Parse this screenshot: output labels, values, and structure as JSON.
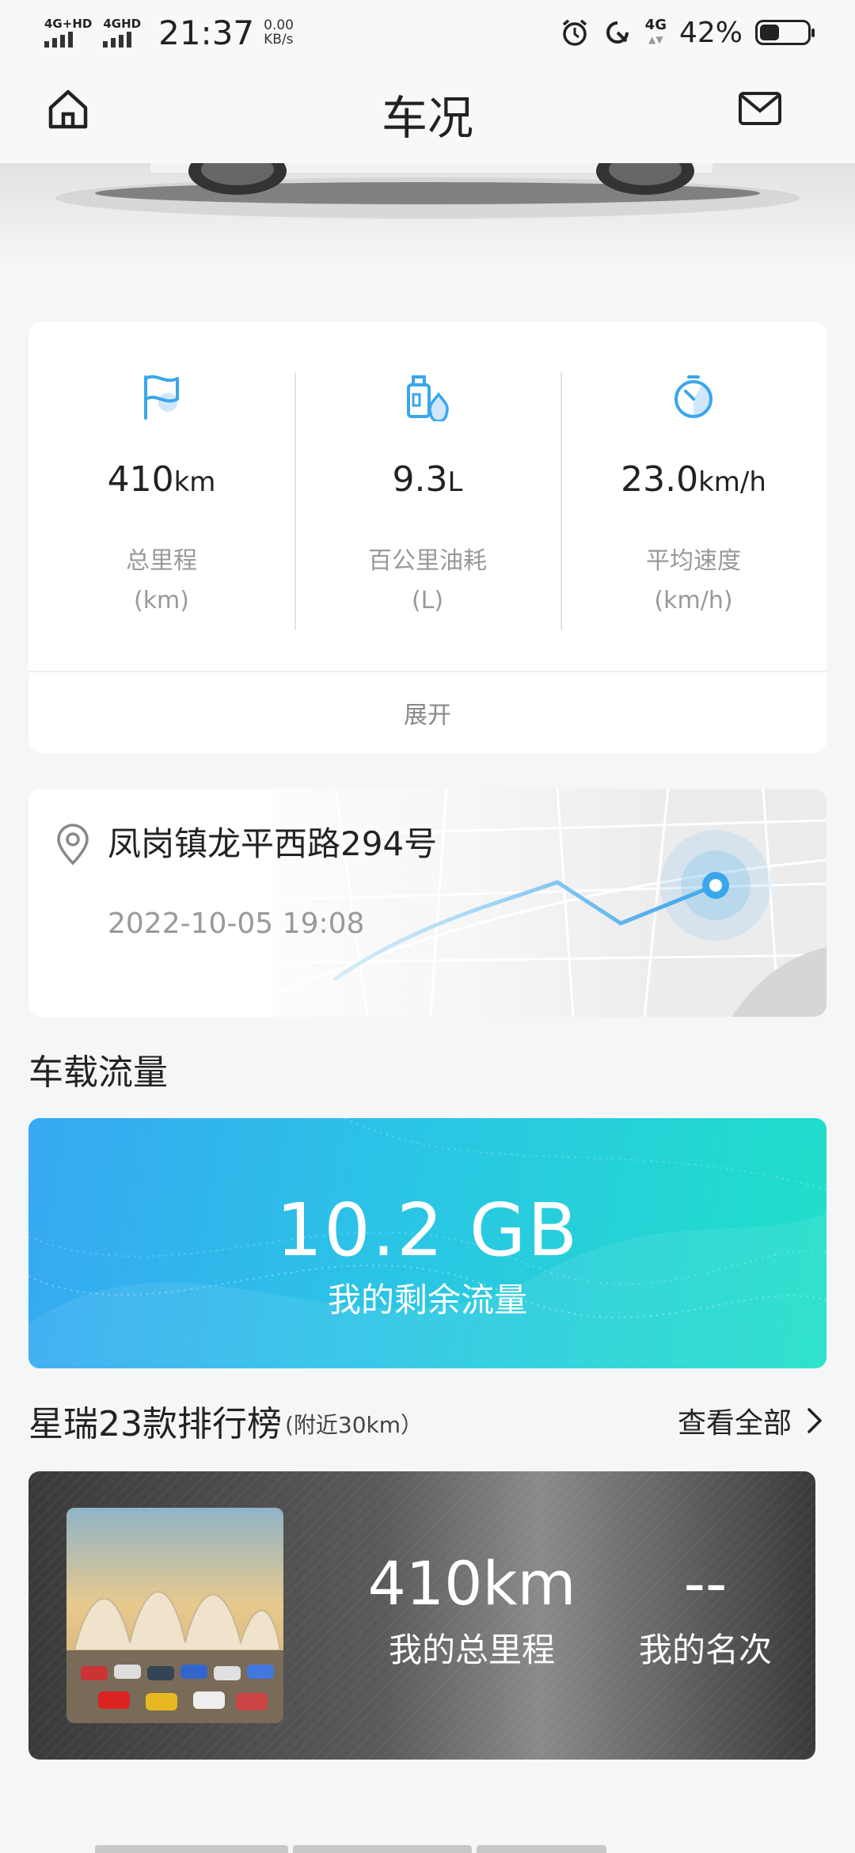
{
  "status_bar": {
    "sim1_label": "4G+HD",
    "sim2_label": "4GHD",
    "time": "21:37",
    "net_speed_value": "0.00",
    "net_speed_unit": "KB/s",
    "network_label": "4G",
    "battery_percent": "42%",
    "battery_level": 0.42,
    "icons": [
      "alarm-icon",
      "sync-icon",
      "network-4g-icon",
      "battery-icon"
    ]
  },
  "header": {
    "title": "车况",
    "left_icon": "home-icon",
    "right_icon": "mail-icon"
  },
  "stats": {
    "items": [
      {
        "icon": "flag-icon",
        "value": "410",
        "unit": "km",
        "name": "总里程",
        "sub": "(km)"
      },
      {
        "icon": "fuel-icon",
        "value": "9.3",
        "unit": "L",
        "name": "百公里油耗",
        "sub": "(L)"
      },
      {
        "icon": "speed-icon",
        "value": "23.0",
        "unit": "km/h",
        "name": "平均速度",
        "sub": "(km/h)"
      }
    ],
    "expand_label": "展开"
  },
  "location": {
    "address": "凤岗镇龙平西路294号",
    "time": "2022-10-05 19:08"
  },
  "data_section": {
    "title": "车载流量",
    "remaining": "10.2 GB",
    "remaining_label": "我的剩余流量"
  },
  "ranking": {
    "title": "星瑞23款排行榜",
    "subtitle": "(附近30km）",
    "more_label": "查看全部",
    "mileage_value": "410km",
    "mileage_label": "我的总里程",
    "rank_value": "--",
    "rank_label": "我的名次"
  },
  "colors": {
    "accent_blue": "#3aa6ec",
    "data_card_start": "#37a8f2",
    "data_card_end": "#1fe0c8"
  }
}
